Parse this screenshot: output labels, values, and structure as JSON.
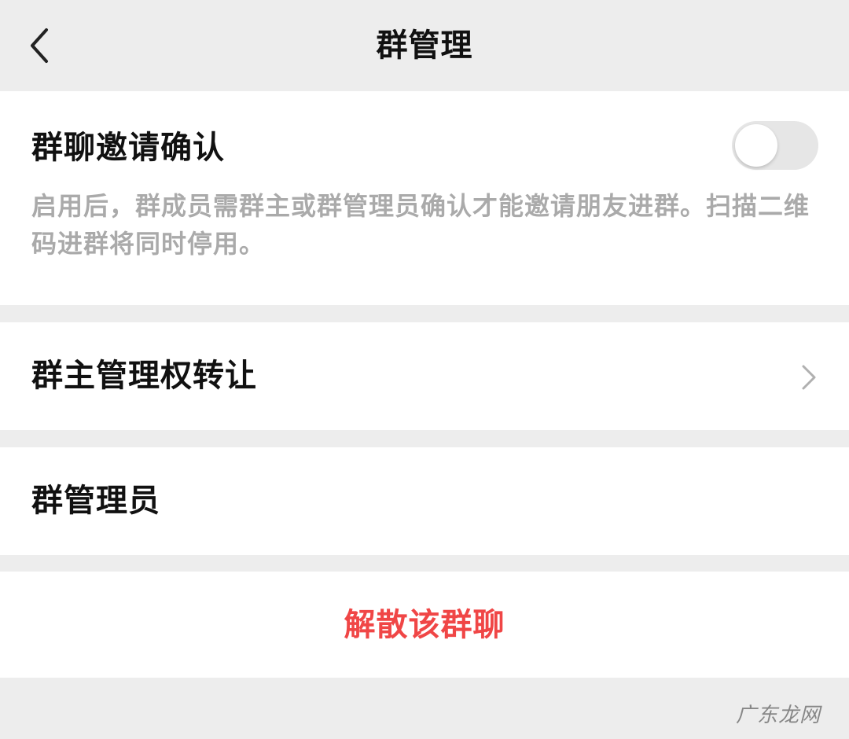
{
  "header": {
    "title": "群管理",
    "back_icon": "chevron-left-icon"
  },
  "invite_confirm": {
    "label": "群聊邀请确认",
    "description": "启用后，群成员需群主或群管理员确认才能邀请朋友进群。扫描二维码进群将同时停用。",
    "toggle_on": false
  },
  "transfer_ownership": {
    "label": "群主管理权转让",
    "chevron_icon": "chevron-right-icon"
  },
  "group_admins": {
    "label": "群管理员"
  },
  "dissolve": {
    "label": "解散该群聊",
    "color": "#f04646"
  },
  "watermark": {
    "text": "广东龙网"
  }
}
